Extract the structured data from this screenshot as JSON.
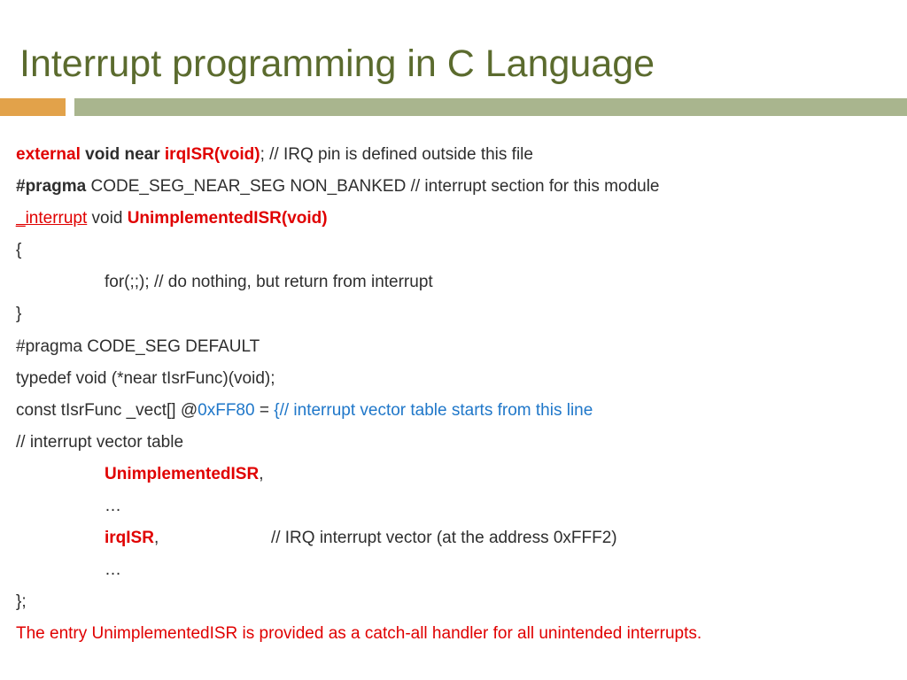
{
  "title": "Interrupt programming in C Language",
  "l1_external": "external",
  "l1_voidnear": " void near ",
  "l1_irq": "irqISR(void)",
  "l1_rest": "; // IRQ pin is defined outside this file",
  "l2_pragma": "#pragma",
  "l2_rest": " CODE_SEG_NEAR_SEG NON_BANKED // interrupt section for this module",
  "l3_interrupt": "_interrupt",
  "l3_void": "  void  ",
  "l3_func": "UnimplementedISR(void)",
  "l4": "{",
  "l5": "for(;;); // do nothing, but return from interrupt",
  "l6": "}",
  "l7": "#pragma CODE_SEG DEFAULT",
  "l8": "typedef void (*near tIsrFunc)(void);",
  "l9_a": "const tIsrFunc _vect[] @",
  "l9_addr": "0xFF80",
  "l9_eq": " = ",
  "l9_brace": "{// interrupt vector table starts from this line",
  "l10": "// interrupt vector table",
  "l11_name": "UnimplementedISR",
  "l11_comma": ",",
  "l12": "…",
  "l13_name": "irqISR",
  "l13_comma": ",",
  "l13_space": "                        ",
  "l13_comment": "// IRQ interrupt vector (at the address 0xFFF2)",
  "l14": "…",
  "l15": "};",
  "footer": "The entry UnimplementedISR is provided as a catch-all handler for all unintended interrupts."
}
